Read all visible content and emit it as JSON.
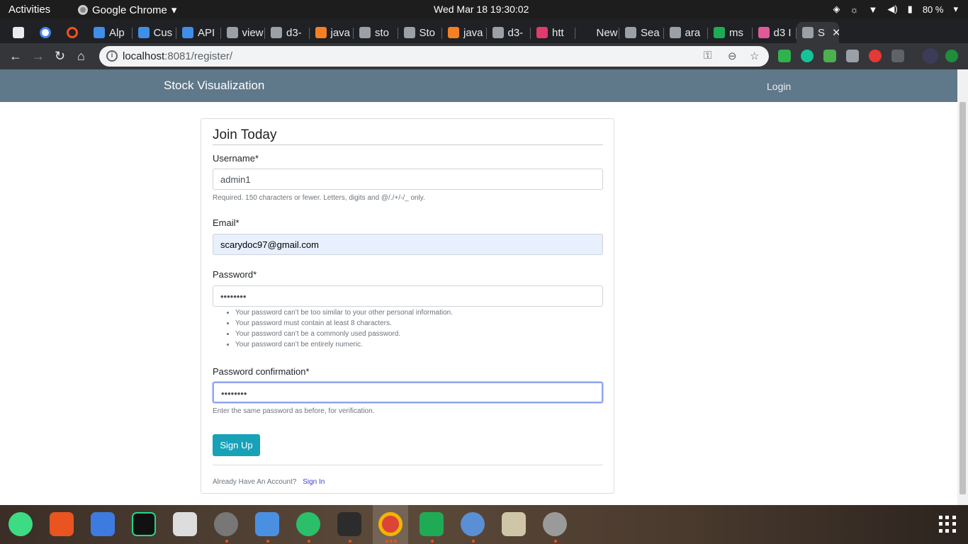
{
  "system": {
    "activities": "Activities",
    "app_name": "Google Chrome",
    "clock": "Wed Mar 18  19:30:02",
    "battery": "80 %"
  },
  "browser": {
    "tabs": [
      {
        "label": "Alp",
        "color": "#3f8ee8"
      },
      {
        "label": "Cus",
        "color": "#3f8ee8"
      },
      {
        "label": "API",
        "color": "#3f8ee8"
      },
      {
        "label": "view",
        "color": "#9aa0a6"
      },
      {
        "label": "d3-",
        "color": "#9aa0a6"
      },
      {
        "label": "java",
        "color": "#f48024"
      },
      {
        "label": "sto",
        "color": "#9aa0a6"
      },
      {
        "label": "Sto",
        "color": "#9aa0a6"
      },
      {
        "label": "java",
        "color": "#f48024"
      },
      {
        "label": "d3-",
        "color": "#9aa0a6"
      },
      {
        "label": "htt",
        "color": "#e03a6f"
      },
      {
        "label": "New Ta",
        "color": "#202124"
      },
      {
        "label": "Sea",
        "color": "#9aa0a6"
      },
      {
        "label": "ara",
        "color": "#9aa0a6"
      },
      {
        "label": "ms",
        "color": "#1faa55"
      },
      {
        "label": "d3 I",
        "color": "#e05a9a"
      },
      {
        "label": "S",
        "color": "#9aa0a6"
      }
    ],
    "url_host": "localhost",
    "url_path": ":8081/register/"
  },
  "site": {
    "brand": "Stock Visualization",
    "login_link": "Login"
  },
  "form": {
    "title": "Join Today",
    "username_label": "Username*",
    "username_value": "admin1",
    "username_help": "Required. 150 characters or fewer. Letters, digits and @/./+/-/_ only.",
    "email_label": "Email*",
    "email_value": "scarydoc97@gmail.com",
    "password_label": "Password*",
    "password_value": "••••••••",
    "password_rules": [
      "Your password can’t be too similar to your other personal information.",
      "Your password must contain at least 8 characters.",
      "Your password can’t be a commonly used password.",
      "Your password can’t be entirely numeric."
    ],
    "confirm_label": "Password confirmation*",
    "confirm_value": "••••••••",
    "confirm_help": "Enter the same password as before, for verification.",
    "submit_label": "Sign Up",
    "already_text": "Already Have An Account?",
    "signin_link": "Sign In"
  },
  "colors": {
    "navbar": "#5f788a",
    "button": "#17a2b8",
    "link": "#3a3fd6"
  }
}
